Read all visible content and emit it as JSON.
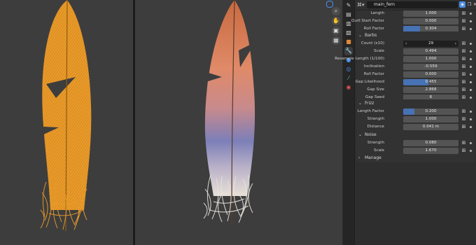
{
  "header": {
    "object_name": "main_fern"
  },
  "general": [
    {
      "label": "Length",
      "value": "1.000",
      "fill": 0
    },
    {
      "label": "Quill Start Factor",
      "value": "0.000",
      "fill": 0
    },
    {
      "label": "Roll Factor",
      "value": "0.304",
      "fill": 0.304
    }
  ],
  "barbs": {
    "title": "Barbs",
    "count_label": "Count (x10)",
    "count_value": "29",
    "rows": [
      {
        "label": "Scale",
        "value": "0.494",
        "fill": 0
      },
      {
        "label": "Resample Length (1/100)",
        "value": "1.000",
        "fill": 0
      },
      {
        "label": "Inclination",
        "value": "-0.559",
        "fill": 0
      },
      {
        "label": "Roll Factor",
        "value": "0.000",
        "fill": 0
      },
      {
        "label": "Gap Likelihood",
        "value": "0.455",
        "fill": 0.455
      },
      {
        "label": "Gap Size",
        "value": "2.868",
        "fill": 0
      },
      {
        "label": "Gap Seed",
        "value": "6",
        "fill": 0
      }
    ]
  },
  "frizz": {
    "title": "Frizz",
    "rows": [
      {
        "label": "Length Factor",
        "value": "0.200",
        "fill": 0.2
      },
      {
        "label": "Strength",
        "value": "1.000",
        "fill": 0
      },
      {
        "label": "Distance",
        "value": "0.041 m",
        "fill": 0
      }
    ]
  },
  "noise": {
    "title": "Noise",
    "rows": [
      {
        "label": "Strength",
        "value": "0.080",
        "fill": 0
      },
      {
        "label": "Scale",
        "value": "1.670",
        "fill": 0
      }
    ]
  },
  "manage": {
    "title": "Manage"
  },
  "colors": {
    "accent": "#4772b3",
    "feather_left": "#e89a2a"
  }
}
